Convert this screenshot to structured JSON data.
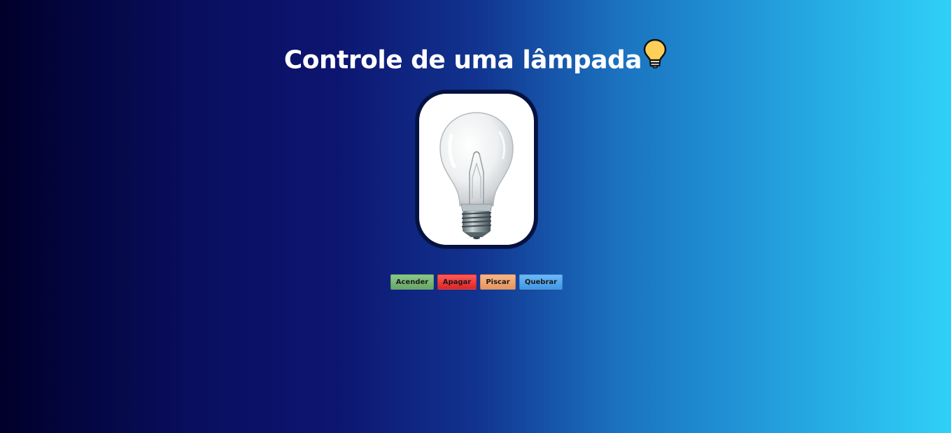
{
  "page": {
    "title": "Controle de uma lâmpada"
  },
  "lamp": {
    "state": "off"
  },
  "controls": {
    "on_label": "Acender",
    "off_label": "Apagar",
    "blink_label": "Piscar",
    "break_label": "Quebrar"
  },
  "colors": {
    "gradient_start": "#00002a",
    "gradient_end": "#2fd0f8",
    "on_button": "#77b876",
    "off_button": "#f03a3a",
    "blink_button": "#efa672",
    "break_button": "#56a8ee"
  }
}
